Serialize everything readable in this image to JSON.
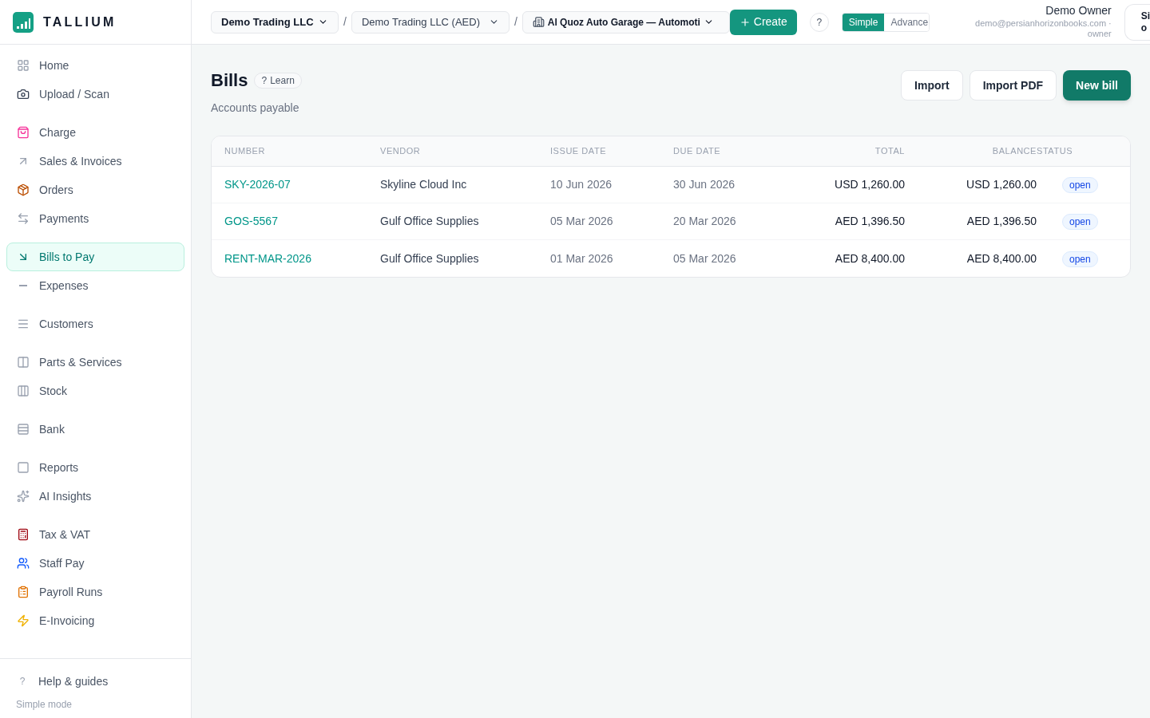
{
  "brand": {
    "name": "TALLIUM"
  },
  "sidebar": {
    "groups": [
      [
        {
          "label": "Home",
          "selected": false
        },
        {
          "label": "Upload / Scan",
          "selected": false
        }
      ],
      [
        {
          "label": "Charge",
          "selected": false
        },
        {
          "label": "Sales & Invoices",
          "selected": false
        },
        {
          "label": "Orders",
          "selected": false
        },
        {
          "label": "Payments",
          "selected": false
        }
      ],
      [
        {
          "label": "Bills to Pay",
          "selected": true
        },
        {
          "label": "Expenses",
          "selected": false
        }
      ],
      [
        {
          "label": "Customers",
          "selected": false
        }
      ],
      [
        {
          "label": "Parts & Services",
          "selected": false
        },
        {
          "label": "Stock",
          "selected": false
        }
      ],
      [
        {
          "label": "Bank",
          "selected": false
        }
      ],
      [
        {
          "label": "Reports",
          "selected": false
        },
        {
          "label": "AI Insights",
          "selected": false
        }
      ],
      [
        {
          "label": "Tax & VAT",
          "selected": false
        },
        {
          "label": "Staff Pay",
          "selected": false
        },
        {
          "label": "Payroll Runs",
          "selected": false
        },
        {
          "label": "E-Invoicing",
          "selected": false
        }
      ]
    ],
    "help": "Help & guides",
    "mode": "Simple mode"
  },
  "topbar": {
    "company": "Demo Trading LLC",
    "ledger": "Demo Trading LLC (AED)",
    "branch": "Al Quoz Auto Garage — Automoti",
    "separator": "/",
    "create": "Create",
    "help": "?",
    "modes": [
      {
        "label": "Simple",
        "selected": true
      },
      {
        "label": "Advance",
        "selected": false
      }
    ],
    "user": {
      "name": "Demo Owner",
      "email": "demo@persianhorizonbooks.com ·",
      "role": "owner"
    },
    "sign_out": [
      "Si",
      "o"
    ]
  },
  "page": {
    "title": "Bills",
    "learn": "Learn",
    "learn_mark": "?",
    "subtitle": "Accounts payable",
    "actions": [
      {
        "label": "Import",
        "kind": "secondary"
      },
      {
        "label": "Import PDF",
        "kind": "secondary"
      },
      {
        "label": "New bill",
        "kind": "primary"
      }
    ]
  },
  "table": {
    "columns": [
      "NUMBER",
      "VENDOR",
      "ISSUE DATE",
      "DUE DATE",
      "TOTAL",
      "BALANCE",
      "STATUS"
    ],
    "rows": [
      {
        "number": "SKY-2026-07",
        "vendor": "Skyline Cloud Inc",
        "issue": "10 Jun 2026",
        "due": "30 Jun 2026",
        "total": "USD 1,260.00",
        "balance": "USD 1,260.00",
        "status": "open"
      },
      {
        "number": "GOS-5567",
        "vendor": "Gulf Office Supplies",
        "issue": "05 Mar 2026",
        "due": "20 Mar 2026",
        "total": "AED 1,396.50",
        "balance": "AED 1,396.50",
        "status": "open"
      },
      {
        "number": "RENT-MAR-2026",
        "vendor": "Gulf Office Supplies",
        "issue": "01 Mar 2026",
        "due": "05 Mar 2026",
        "total": "AED 8,400.00",
        "balance": "AED 8,400.00",
        "status": "open"
      }
    ]
  }
}
